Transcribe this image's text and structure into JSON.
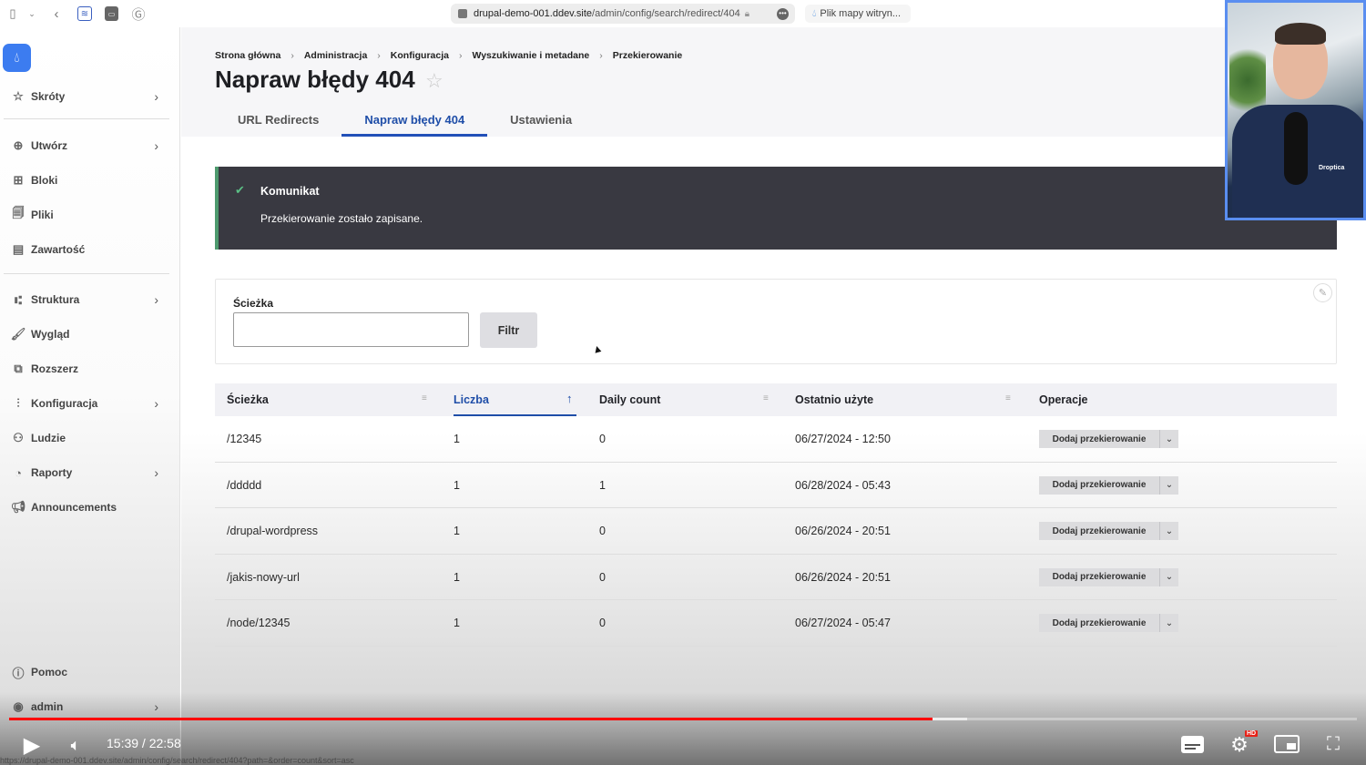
{
  "browser": {
    "url_domain": "drupal-demo-001.ddev.site",
    "url_path": "/admin/config/search/redirect/404",
    "other_tab_label": "Plik mapy witryn..."
  },
  "sidebar": {
    "items": [
      {
        "label": "Skróty",
        "icon": "star-icon",
        "has_children": true
      },
      {
        "label": "Utwórz",
        "icon": "plus-circle-icon",
        "has_children": true
      },
      {
        "label": "Bloki",
        "icon": "blocks-icon",
        "has_children": false
      },
      {
        "label": "Pliki",
        "icon": "files-icon",
        "has_children": false
      },
      {
        "label": "Zawartość",
        "icon": "content-icon",
        "has_children": false
      },
      {
        "label": "Struktura",
        "icon": "structure-icon",
        "has_children": true
      },
      {
        "label": "Wygląd",
        "icon": "brush-icon",
        "has_children": false
      },
      {
        "label": "Rozszerz",
        "icon": "puzzle-icon",
        "has_children": false
      },
      {
        "label": "Konfiguracja",
        "icon": "sliders-icon",
        "has_children": true
      },
      {
        "label": "Ludzie",
        "icon": "people-icon",
        "has_children": false
      },
      {
        "label": "Raporty",
        "icon": "chart-icon",
        "has_children": true
      },
      {
        "label": "Announcements",
        "icon": "megaphone-icon",
        "has_children": false
      }
    ],
    "help_label": "Pomoc",
    "user_label": "admin"
  },
  "breadcrumb": [
    "Strona główna",
    "Administracja",
    "Konfiguracja",
    "Wyszukiwanie i metadane",
    "Przekierowanie"
  ],
  "page": {
    "title": "Napraw błędy 404",
    "tabs": [
      {
        "label": "URL Redirects",
        "active": false
      },
      {
        "label": "Napraw błędy 404",
        "active": true
      },
      {
        "label": "Ustawienia",
        "active": false
      }
    ]
  },
  "message": {
    "title": "Komunikat",
    "text": "Przekierowanie zostało zapisane.",
    "status_color": "#4e9a6e"
  },
  "filter": {
    "label": "Ścieżka",
    "value": "",
    "button_label": "Filtr"
  },
  "table": {
    "columns": [
      {
        "label": "Ścieżka",
        "sortable": true,
        "sorted": false
      },
      {
        "label": "Liczba",
        "sortable": true,
        "sorted": true,
        "direction": "asc"
      },
      {
        "label": "Daily count",
        "sortable": true,
        "sorted": false
      },
      {
        "label": "Ostatnio użyte",
        "sortable": true,
        "sorted": false
      },
      {
        "label": "Operacje",
        "sortable": false,
        "sorted": false
      }
    ],
    "rows": [
      {
        "path": "/12345",
        "count": "1",
        "daily": "0",
        "last_used": "06/27/2024 - 12:50",
        "op": "Dodaj przekierowanie"
      },
      {
        "path": "/ddddd",
        "count": "1",
        "daily": "1",
        "last_used": "06/28/2024 - 05:43",
        "op": "Dodaj przekierowanie"
      },
      {
        "path": "/drupal-wordpress",
        "count": "1",
        "daily": "0",
        "last_used": "06/26/2024 - 20:51",
        "op": "Dodaj przekierowanie"
      },
      {
        "path": "/jakis-nowy-url",
        "count": "1",
        "daily": "0",
        "last_used": "06/26/2024 - 20:51",
        "op": "Dodaj przekierowanie"
      },
      {
        "path": "/node/12345",
        "count": "1",
        "daily": "0",
        "last_used": "06/27/2024 - 05:47",
        "op": "Dodaj przekierowanie"
      }
    ]
  },
  "video": {
    "current_time": "15:39",
    "duration": "22:58",
    "time_display": "15:39 / 22:58",
    "played_fraction": 0.685,
    "buffered_fraction": 0.711,
    "quality_badge": "HD",
    "webcam_brand": "Droptica",
    "accent_color": "#ff0000"
  },
  "status_bar_url": "https://drupal-demo-001.ddev.site/admin/config/search/redirect/404?path=&order=count&sort=asc",
  "colors": {
    "brand": "#3c7cf0",
    "active_tab": "#1f4ea8",
    "message_bg": "#393941"
  }
}
